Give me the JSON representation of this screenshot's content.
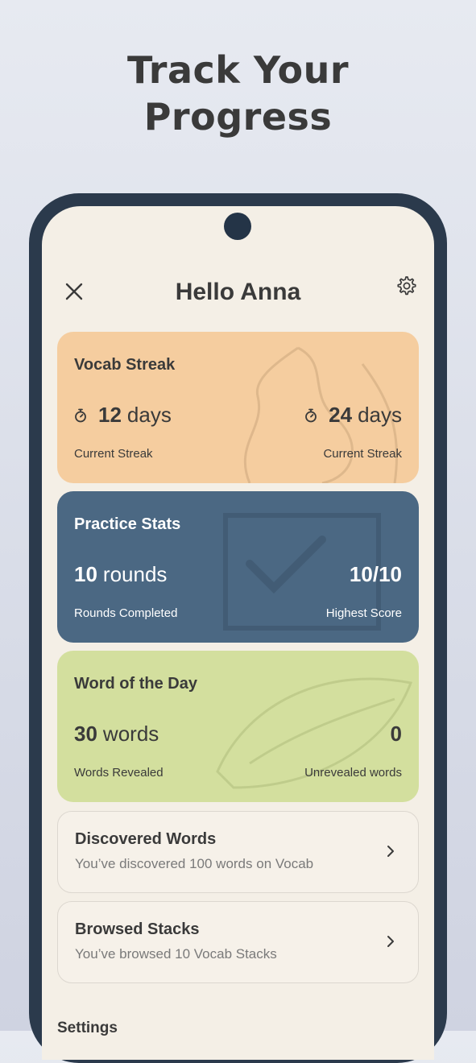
{
  "headline": {
    "line1": "Track Your",
    "line2": "Progress"
  },
  "header": {
    "greeting": "Hello Anna",
    "close_icon": "close-icon",
    "settings_icon": "gear-icon"
  },
  "cards": {
    "streak": {
      "title": "Vocab Streak",
      "left_value": "12",
      "left_unit": "days",
      "left_caption": "Current Streak",
      "right_value": "24",
      "right_unit": "days",
      "right_caption": "Current Streak",
      "icon": "timer-icon",
      "color": "#f5cd9f"
    },
    "practice": {
      "title": "Practice Stats",
      "left_value": "10",
      "left_unit": "rounds",
      "left_caption": "Rounds Completed",
      "right_value": "10/10",
      "right_caption": "Highest Score",
      "color": "#4b6883"
    },
    "wotd": {
      "title": "Word of the Day",
      "left_value": "30",
      "left_unit": "words",
      "left_caption": "Words Revealed",
      "right_value": "0",
      "right_caption": "Unrevealed words",
      "color": "#d3df9e"
    }
  },
  "rows": {
    "discovered": {
      "title": "Discovered Words",
      "subtitle": "You’ve discovered 100 words on Vocab"
    },
    "browsed": {
      "title": "Browsed Stacks",
      "subtitle": "You’ve browsed 10 Vocab Stacks"
    }
  },
  "settings": {
    "heading": "Settings"
  },
  "colors": {
    "phone_frame": "#2b3a4c",
    "screen_bg": "#f4efe6"
  }
}
